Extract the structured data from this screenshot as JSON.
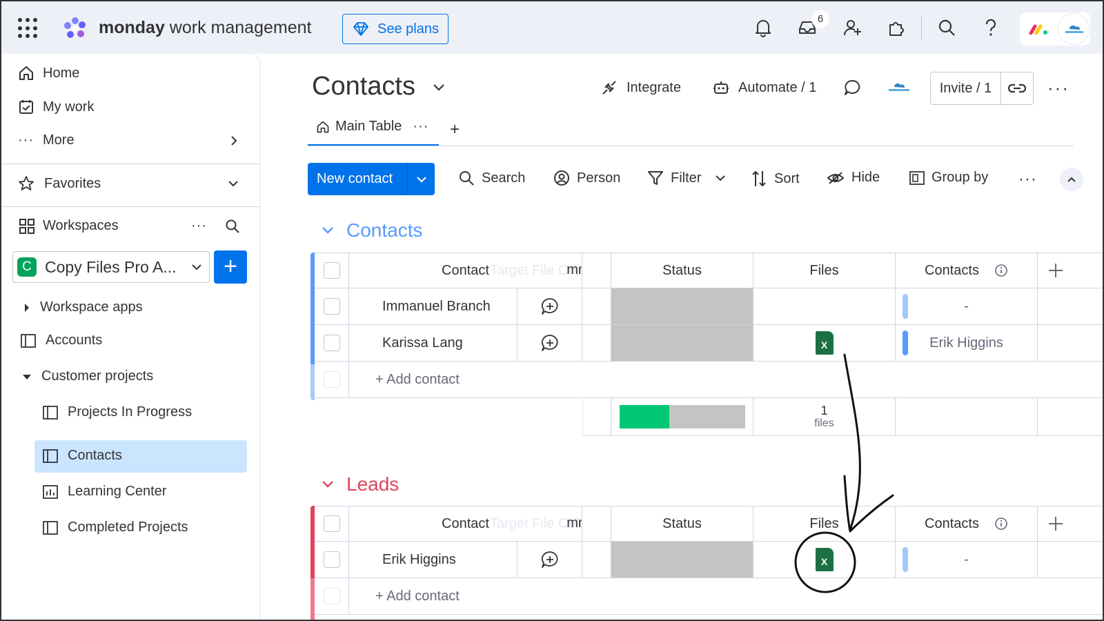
{
  "topbar": {
    "brand_bold": "monday",
    "brand_rest": " work management",
    "see_plans": "See plans",
    "inbox_badge": "6"
  },
  "sidebar": {
    "home": "Home",
    "my_work": "My work",
    "more": "More",
    "favorites": "Favorites",
    "workspaces": "Workspaces",
    "workspace_badge": "C",
    "workspace_name": "Copy Files Pro A...",
    "add": "+",
    "workspace_apps": "Workspace apps",
    "accounts": "Accounts",
    "customer_projects": "Customer projects",
    "projects_in_progress": "Projects In Progress",
    "contacts": "Contacts",
    "learning_center": "Learning Center",
    "completed_projects": "Completed Projects"
  },
  "board": {
    "title": "Contacts",
    "integrate": "Integrate",
    "automate": "Automate / 1",
    "invite": "Invite / 1",
    "tab_main": "Main Table",
    "new_contact": "New contact",
    "tools": {
      "search": "Search",
      "person": "Person",
      "filter": "Filter",
      "sort": "Sort",
      "hide": "Hide",
      "group_by": "Group by"
    }
  },
  "groups": [
    {
      "title": "Contacts",
      "color": "#579bfc",
      "columns": {
        "contact": "Contact",
        "ghost": "Target File Column",
        "hidden_tail": "mn",
        "status": "Status",
        "files": "Files",
        "contacts": "Contacts"
      },
      "rows": [
        {
          "name": "Immanuel Branch",
          "files": "",
          "contacts": "-"
        },
        {
          "name": "Karissa Lang",
          "files": "X",
          "contacts": "Erik Higgins"
        }
      ],
      "add_label": "+ Add contact",
      "summary": {
        "files_count": "1",
        "files_unit": "files",
        "status_green_fraction": 0.4
      }
    },
    {
      "title": "Leads",
      "color": "#e2445c",
      "columns": {
        "contact": "Contact",
        "ghost": "Target File Column",
        "hidden_tail": "mn",
        "status": "Status",
        "files": "Files",
        "contacts": "Contacts"
      },
      "rows": [
        {
          "name": "Erik Higgins",
          "files": "X",
          "contacts": "-"
        }
      ],
      "add_label": "+ Add contact"
    }
  ],
  "colors": {
    "accent": "#0073ea",
    "leads": "#e2445c",
    "contacts_group": "#579bfc",
    "status_done": "#00c875",
    "status_empty": "#c4c4c4",
    "excel": "#1d7044"
  }
}
